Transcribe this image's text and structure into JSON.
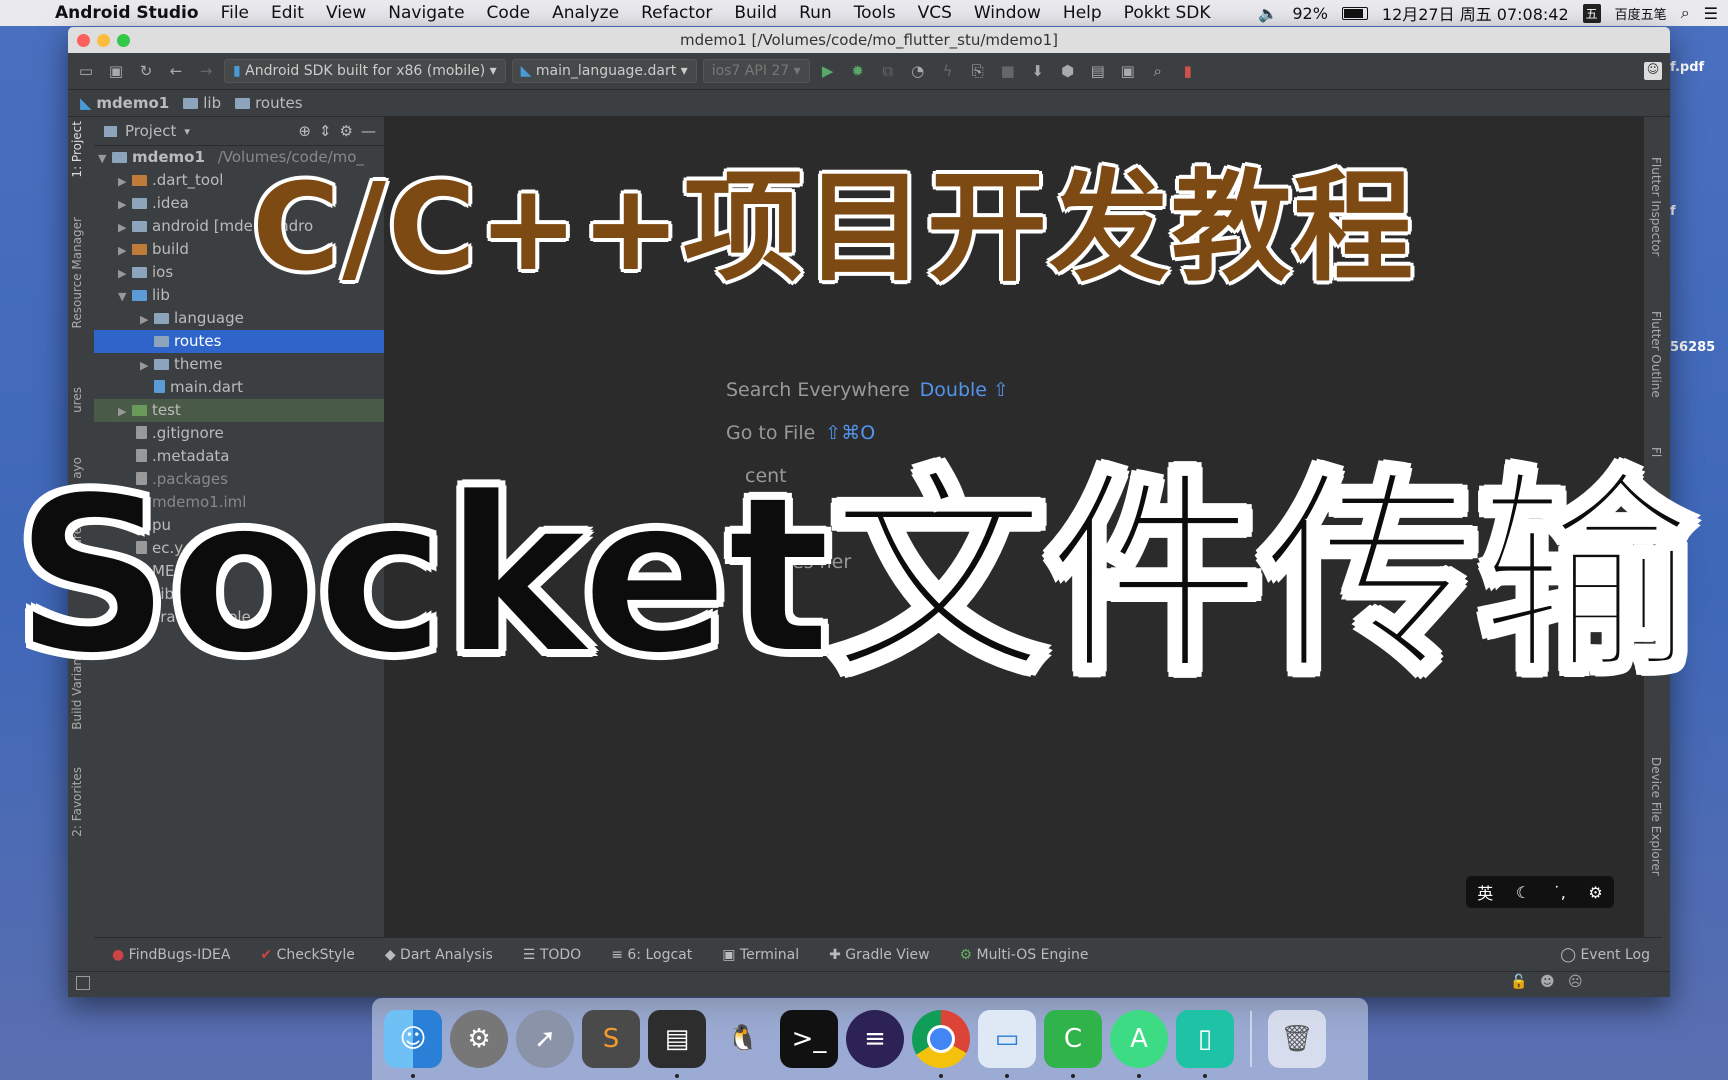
{
  "menubar": {
    "app": "Android Studio",
    "items": [
      "File",
      "Edit",
      "View",
      "Navigate",
      "Code",
      "Analyze",
      "Refactor",
      "Build",
      "Run",
      "Tools",
      "VCS",
      "Window",
      "Help",
      "Pokkt SDK"
    ],
    "battery": "92%",
    "datetime": "12月27日 周五 07:08:42",
    "ime": "百度五笔"
  },
  "window": {
    "title": "mdemo1 [/Volumes/code/mo_flutter_stu/mdemo1]"
  },
  "toolbar": {
    "device": "Android SDK built for x86 (mobile)",
    "run_config": "main_language.dart",
    "ios_device": "ios7 API 27"
  },
  "breadcrumb": {
    "items": [
      "mdemo1",
      "lib",
      "routes"
    ]
  },
  "project": {
    "header": "Project",
    "root": "mdemo1",
    "root_path": "/Volumes/code/mo_",
    "tree": [
      {
        "label": ".dart_tool",
        "depth": 1
      },
      {
        "label": ".idea",
        "depth": 1
      },
      {
        "label": "android [mde",
        "suffix": "1_andro",
        "depth": 1
      },
      {
        "label": "build",
        "depth": 1
      },
      {
        "label": "ios",
        "depth": 1
      },
      {
        "label": "lib",
        "depth": 1
      },
      {
        "label": "language",
        "depth": 2
      },
      {
        "label": "routes",
        "depth": 2
      },
      {
        "label": "theme",
        "depth": 2
      },
      {
        "label": "main.dart",
        "depth": 2
      },
      {
        "label": "test",
        "depth": 1
      },
      {
        "label": ".gitignore",
        "depth": 1
      },
      {
        "label": ".metadata",
        "depth": 1
      },
      {
        "label": ".packages",
        "depth": 1
      },
      {
        "label": "mdemo1.iml",
        "depth": 1
      },
      {
        "label": "pu",
        "depth": 1
      },
      {
        "label": "ec.y",
        "depth": 1
      },
      {
        "label": "ME.m",
        "depth": 1
      },
      {
        "label": "Libra",
        "depth": 1
      },
      {
        "label": "cra",
        "suffix": "sole",
        "depth": 1
      }
    ]
  },
  "left_tabs": {
    "project": "1: Project",
    "resource_manager": "Resource Manager",
    "structure": "ures",
    "layout": "ayo",
    "captures": "ure",
    "build_variants": "Build Variants",
    "favorites": "2: Favorites"
  },
  "right_tabs": {
    "flutter_inspector": "Flutter Inspector",
    "flutter_outline": "Flutter Outline",
    "flutter_perf": "Fl",
    "device_file_explorer": "Device File Explorer"
  },
  "editor_hints": {
    "search": "Search Everywhere",
    "search_key": "Double ⇧",
    "goto": "Go to File",
    "goto_key": "⇧⌘O",
    "recent": "cent",
    "navigation": "ation",
    "navigation_key": "⌘↑",
    "drop": "op files her"
  },
  "bottom_tabs": [
    "FindBugs-IDEA",
    "CheckStyle",
    "Dart Analysis",
    "TODO",
    "6: Logcat",
    "Terminal",
    "Gradle View",
    "Multi-OS Engine"
  ],
  "event_log": "Event Log",
  "desktop": {
    "file1": "f.pdf",
    "file2": "f",
    "number": "56285"
  },
  "ime_toolbar": {
    "lang": "英"
  },
  "overlay": {
    "line1": "C/C++项目开发教程",
    "line2": "Socket文件传输"
  }
}
